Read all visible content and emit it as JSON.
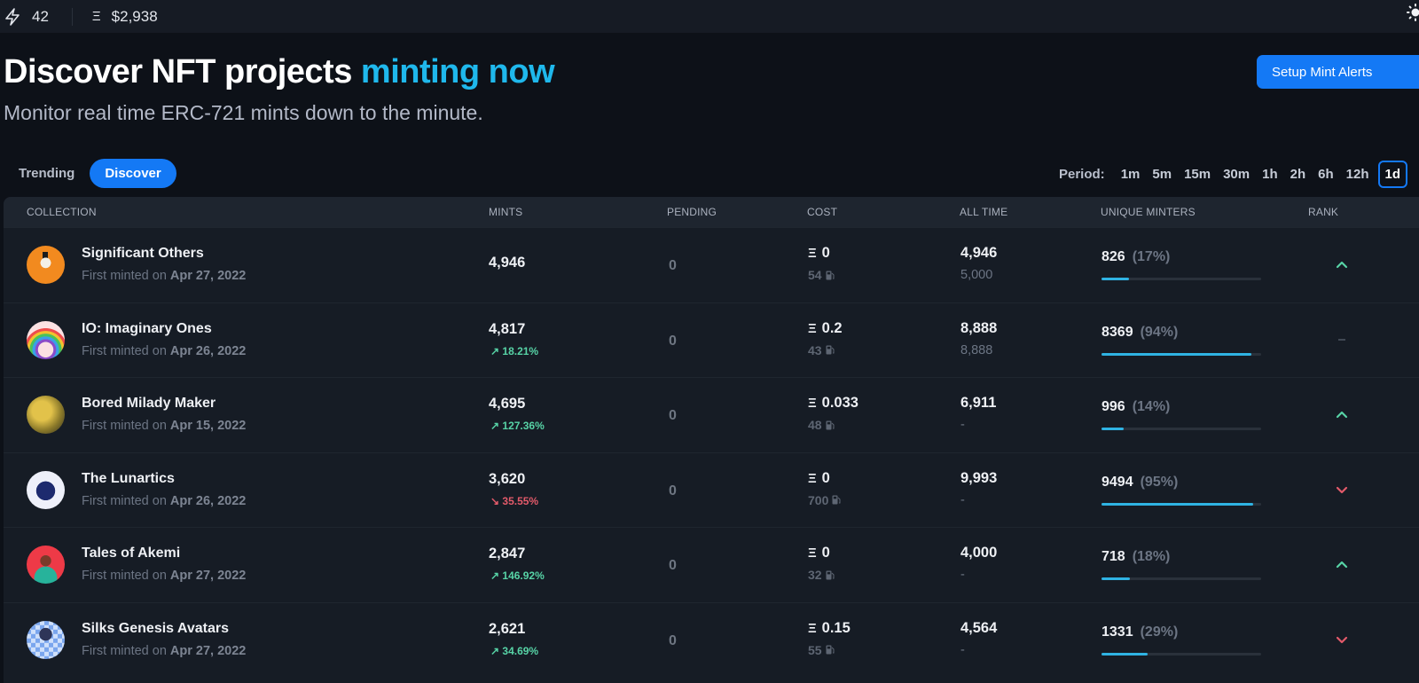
{
  "topbar": {
    "gas_icon": "lightning-bolt-icon",
    "gas_value": "42",
    "eth_icon": "ethereum-icon",
    "eth_glyph": "Ξ",
    "eth_price": "$2,938",
    "theme_icon": "sun-icon"
  },
  "hero": {
    "title_main": "Discover NFT projects ",
    "title_accent": "minting now",
    "subtitle": "Monitor real time ERC-721 mints down to the minute.",
    "alerts_button": "Setup Mint Alerts"
  },
  "tabs": [
    {
      "label": "Trending",
      "active": false
    },
    {
      "label": "Discover",
      "active": true
    }
  ],
  "period": {
    "label": "Period:",
    "options": [
      "1m",
      "5m",
      "15m",
      "30m",
      "1h",
      "2h",
      "6h",
      "12h",
      "1d"
    ],
    "selected": "1d"
  },
  "table": {
    "columns": [
      "COLLECTION",
      "MINTS",
      "PENDING",
      "COST",
      "ALL TIME",
      "UNIQUE MINTERS",
      "RANK"
    ],
    "minted_prefix": "First minted on ",
    "eth_glyph": "Ξ",
    "rows": [
      {
        "name": "Significant Others",
        "first_minted": "Apr 27, 2022",
        "mints": "4,946",
        "change": "",
        "change_dir": "none",
        "pending": "0",
        "cost": "0",
        "gas": "54",
        "all_time": "4,946",
        "supply": "5,000",
        "unique_minters": "826",
        "unique_pct": "(17%)",
        "unique_fraction": 0.17,
        "rank": "up",
        "avatar": "orange"
      },
      {
        "name": "IO: Imaginary Ones",
        "first_minted": "Apr 26, 2022",
        "mints": "4,817",
        "change": "18.21%",
        "change_dir": "up",
        "pending": "0",
        "cost": "0.2",
        "gas": "43",
        "all_time": "8,888",
        "supply": "8,888",
        "unique_minters": "8369",
        "unique_pct": "(94%)",
        "unique_fraction": 0.94,
        "rank": "same",
        "avatar": "rainbow"
      },
      {
        "name": "Bored Milady Maker",
        "first_minted": "Apr 15, 2022",
        "mints": "4,695",
        "change": "127.36%",
        "change_dir": "up",
        "pending": "0",
        "cost": "0.033",
        "gas": "48",
        "all_time": "6,911",
        "supply": "-",
        "unique_minters": "996",
        "unique_pct": "(14%)",
        "unique_fraction": 0.14,
        "rank": "up",
        "avatar": "gold"
      },
      {
        "name": "The Lunartics",
        "first_minted": "Apr 26, 2022",
        "mints": "3,620",
        "change": "35.55%",
        "change_dir": "down",
        "pending": "0",
        "cost": "0",
        "gas": "700",
        "all_time": "9,993",
        "supply": "-",
        "unique_minters": "9494",
        "unique_pct": "(95%)",
        "unique_fraction": 0.95,
        "rank": "down",
        "avatar": "navy"
      },
      {
        "name": "Tales of Akemi",
        "first_minted": "Apr 27, 2022",
        "mints": "2,847",
        "change": "146.92%",
        "change_dir": "up",
        "pending": "0",
        "cost": "0",
        "gas": "32",
        "all_time": "4,000",
        "supply": "-",
        "unique_minters": "718",
        "unique_pct": "(18%)",
        "unique_fraction": 0.18,
        "rank": "up",
        "avatar": "red"
      },
      {
        "name": "Silks Genesis Avatars",
        "first_minted": "Apr 27, 2022",
        "mints": "2,621",
        "change": "34.69%",
        "change_dir": "up",
        "pending": "0",
        "cost": "0.15",
        "gas": "55",
        "all_time": "4,564",
        "supply": "-",
        "unique_minters": "1331",
        "unique_pct": "(29%)",
        "unique_fraction": 0.29,
        "rank": "down",
        "avatar": "checker"
      }
    ]
  },
  "colors": {
    "accent": "#1479f5",
    "title_accent": "#1fb8ec",
    "up": "#57d3a6",
    "down": "#e25a6a",
    "bar_fill": "#2fb3e3"
  }
}
